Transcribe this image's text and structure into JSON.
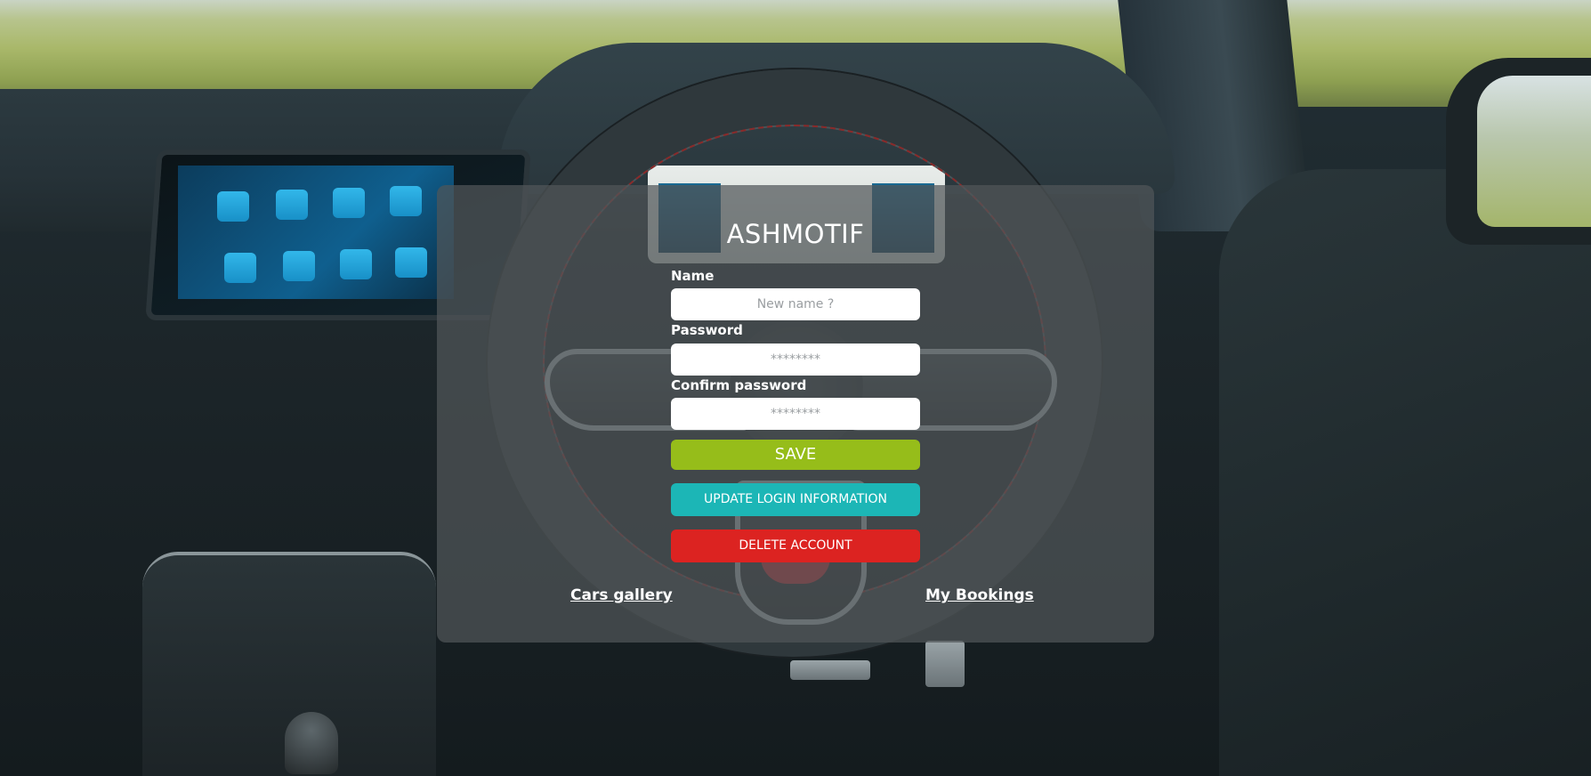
{
  "brand": {
    "title": "ASHMOTIF"
  },
  "form": {
    "name": {
      "label": "Name",
      "value": "",
      "placeholder": "New name ?"
    },
    "password": {
      "label": "Password",
      "value": "",
      "placeholder": "********"
    },
    "confirm_password": {
      "label": "Confirm password",
      "value": "",
      "placeholder": "********"
    }
  },
  "buttons": {
    "save": "SAVE",
    "update_login": "UPDATE LOGIN INFORMATION",
    "delete_account": "DELETE ACCOUNT"
  },
  "links": {
    "cars_gallery": "Cars gallery",
    "my_bookings": "My Bookings"
  },
  "colors": {
    "save": "#96bd1a",
    "update": "#1cb6b6",
    "delete": "#dc2321",
    "overlay": "#50565a"
  }
}
